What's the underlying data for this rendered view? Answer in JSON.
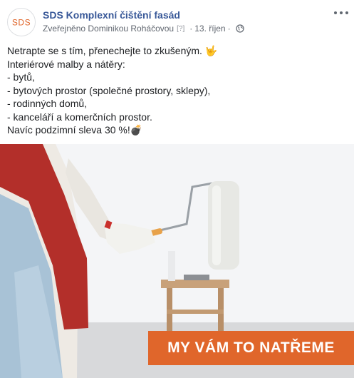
{
  "post": {
    "page_name": "SDS Komplexní čištění fasád",
    "avatar_logo_text": "SDS",
    "published_by": "Zveřejněno Dominikou Roháčovou",
    "info_marker": "[?]",
    "date": "13. říjen",
    "separator": "·",
    "lines": [
      "Netrapte se s tím, přenechejte to zkušeným. 🤟",
      "Interiérové malby a nátěry:",
      "- bytů,",
      "- bytových prostor (společné prostory, sklepy),",
      "- rodinných domů,",
      "- kanceláří a komerčních prostor.",
      "Navíc podzimní sleva 30 %!💣"
    ],
    "image_banner_text": "MY VÁM TO NATŘEME"
  },
  "colors": {
    "brand_link": "#385898",
    "logo_red": "#e0662b",
    "banner": "#e0662b"
  }
}
